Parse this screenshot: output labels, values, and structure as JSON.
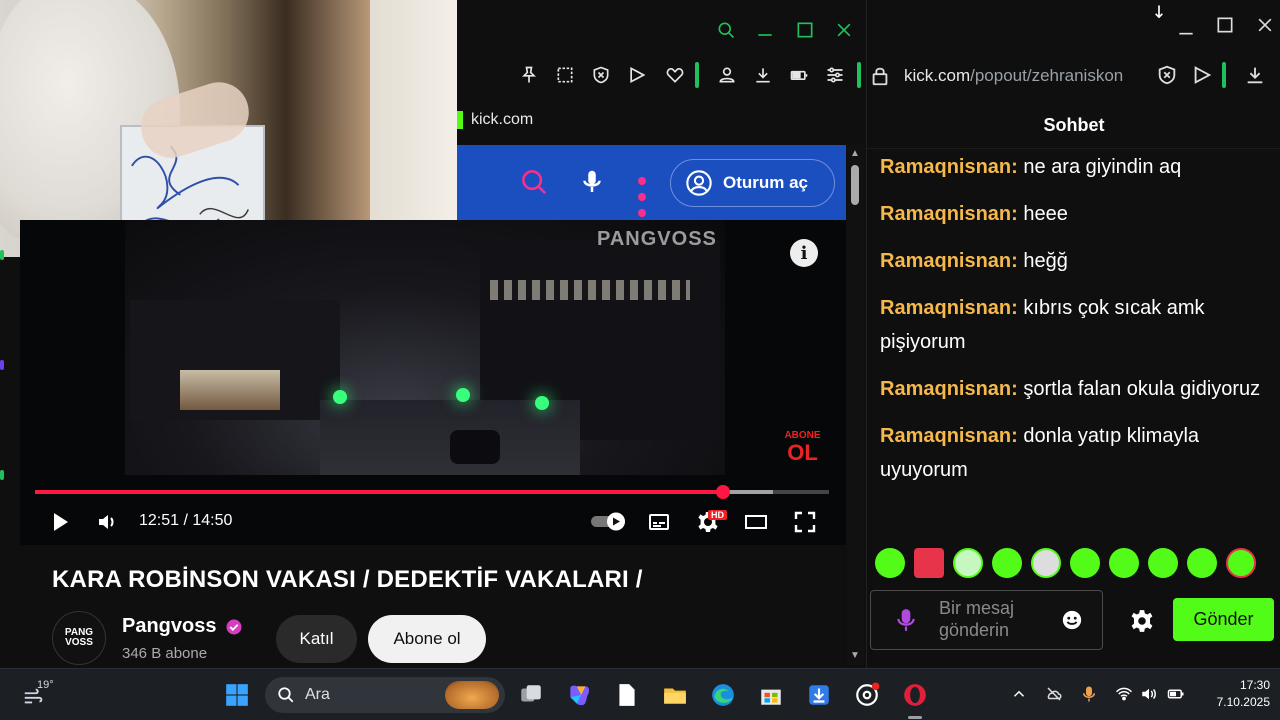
{
  "kick_label": "kick.com",
  "yt_header": {
    "signin_label": "Oturum aç"
  },
  "video": {
    "watermark": "PANGVOSS",
    "abone_logo_top": "ABONE",
    "abone_logo_bottom": "OL",
    "info_label": "i",
    "time": "12:51 / 14:50",
    "progress": 0.8661,
    "buffered": 0.93,
    "hd_badge": "HD"
  },
  "video_info": {
    "title": "KARA ROBİNSON VAKASI / DEDEKTİF VAKALARI /",
    "channel_name": "Pangvoss",
    "channel_avatar_text": "PANG VOSS",
    "subscribers": "346 B abone",
    "join_label": "Katıl",
    "subscribe_label": "Abone ol"
  },
  "chat_window": {
    "url_domain": "kick.com",
    "url_path": "/popout/zehraniskon",
    "header": "Sohbet",
    "messages": [
      {
        "user": "Ramaqnisnan",
        "text": " ne ara giyindin aq"
      },
      {
        "user": "Ramaqnisnan",
        "text": " heee"
      },
      {
        "user": "Ramaqnisnan",
        "text": " heğğ"
      },
      {
        "user": "Ramaqnisnan",
        "text": " kıbrıs çok sıcak amk pişiyorum"
      },
      {
        "user": "Ramaqnisnan",
        "text": " şortla falan okula gidiyoruz"
      },
      {
        "user": "Ramaqnisnan",
        "text": " donla yatıp klimayla uyuyorum"
      }
    ],
    "user_separator": ":",
    "input_placeholder": "Bir mesaj gönderin",
    "send_label": "Gönder",
    "colors": {
      "accent": "#53fc18",
      "username": "#f5b84b"
    }
  },
  "taskbar": {
    "temperature": "19°",
    "search_placeholder": "Ara",
    "time": "17:30",
    "date": "7.10.2025"
  }
}
